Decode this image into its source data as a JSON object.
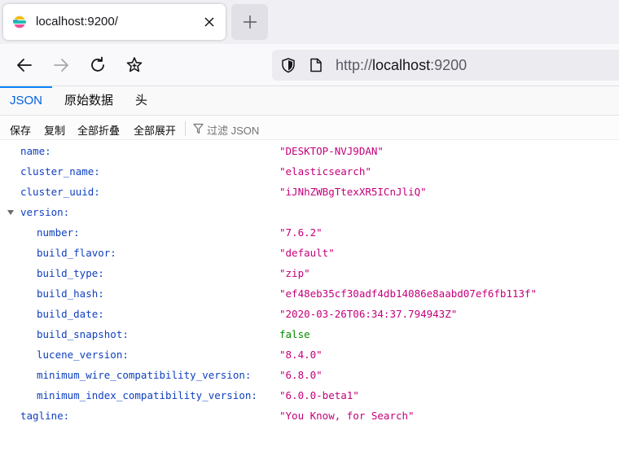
{
  "browser": {
    "tab_title": "localhost:9200/",
    "url_scheme": "http://",
    "url_host": "localhost",
    "url_port": ":9200"
  },
  "viewer_tabs": [
    "JSON",
    "原始数据",
    "头"
  ],
  "toolbar": {
    "save": "保存",
    "copy": "复制",
    "collapse_all": "全部折叠",
    "expand_all": "全部展开",
    "filter_placeholder": "过滤 JSON"
  },
  "json": {
    "name": "\"DESKTOP-NVJ9DAN\"",
    "cluster_name": "\"elasticsearch\"",
    "cluster_uuid": "\"iJNhZWBgTtexXR5ICnJliQ\"",
    "version": {
      "number": "\"7.6.2\"",
      "build_flavor": "\"default\"",
      "build_type": "\"zip\"",
      "build_hash": "\"ef48eb35cf30adf4db14086e8aabd07ef6fb113f\"",
      "build_date": "\"2020-03-26T06:34:37.794943Z\"",
      "build_snapshot": "false",
      "lucene_version": "\"8.4.0\"",
      "minimum_wire_compatibility_version": "\"6.8.0\"",
      "minimum_index_compatibility_version": "\"6.0.0-beta1\""
    },
    "tagline": "\"You Know, for Search\""
  },
  "keys": {
    "name": "name:",
    "cluster_name": "cluster_name:",
    "cluster_uuid": "cluster_uuid:",
    "version": "version:",
    "number": "number:",
    "build_flavor": "build_flavor:",
    "build_type": "build_type:",
    "build_hash": "build_hash:",
    "build_date": "build_date:",
    "build_snapshot": "build_snapshot:",
    "lucene_version": "lucene_version:",
    "minimum_wire_compatibility_version": "minimum_wire_compatibility_version:",
    "minimum_index_compatibility_version": "minimum_index_compatibility_version:",
    "tagline": "tagline:"
  },
  "colors": {
    "key": "#1040c0",
    "string": "#c3007a",
    "boolean": "#058b00",
    "active_tab": "#0060df"
  }
}
